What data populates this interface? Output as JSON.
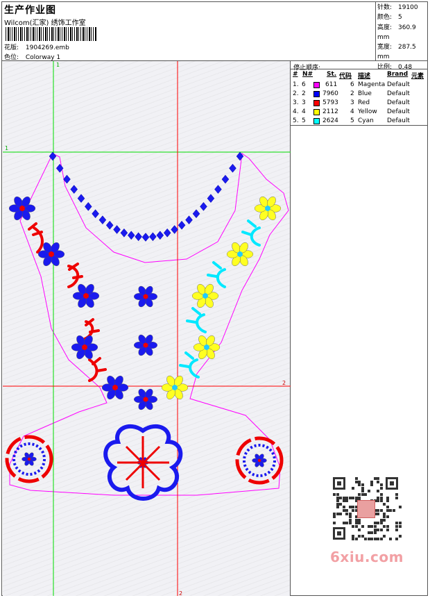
{
  "header": {
    "title": "生产作业图",
    "studio": "Wilcom(汇家) 绣饰工作室",
    "design_label": "花版:",
    "design_value": "1904269.emb",
    "colorway_label": "色位:",
    "colorway_value": "Colorway 1"
  },
  "specs": [
    {
      "label": "针数:",
      "value": "19100"
    },
    {
      "label": "颜色:",
      "value": "5"
    },
    {
      "label": "高度:",
      "value": "360.9 mm"
    },
    {
      "label": "宽度:",
      "value": "287.5 mm"
    },
    {
      "label": "比例:",
      "value": "0.48"
    }
  ],
  "guides": {
    "v1": "1",
    "h1": "1",
    "v2": "2",
    "h2": "2"
  },
  "stop_list": {
    "title": "停止顺序:",
    "headers": {
      "num": "#",
      "needle": "N#",
      "stitch": "St.",
      "code": "代码",
      "desc": "描述",
      "brand": "Brand",
      "element": "元素"
    },
    "rows": [
      {
        "num": "1.",
        "needle": "6",
        "color": "#ff00ff",
        "stitch": "611",
        "code": "6",
        "desc": "Magenta",
        "brand": "Default"
      },
      {
        "num": "2.",
        "needle": "2",
        "color": "#0000ff",
        "stitch": "7960",
        "code": "2",
        "desc": "Blue",
        "brand": "Default"
      },
      {
        "num": "3.",
        "needle": "3",
        "color": "#ff0000",
        "stitch": "5793",
        "code": "3",
        "desc": "Red",
        "brand": "Default"
      },
      {
        "num": "4.",
        "needle": "4",
        "color": "#ffff00",
        "stitch": "2112",
        "code": "4",
        "desc": "Yellow",
        "brand": "Default"
      },
      {
        "num": "5.",
        "needle": "5",
        "color": "#00ffff",
        "stitch": "2624",
        "code": "5",
        "desc": "Cyan",
        "brand": "Default"
      }
    ]
  },
  "watermark": {
    "site": "6xiu.com"
  },
  "colors": {
    "magenta": "#ff00ff",
    "blue": "#1010e0",
    "red": "#ee0000",
    "yellow": "#ffff22",
    "cyan": "#00ffff",
    "guide_green": "#00dd00",
    "guide_red": "#ff0000"
  }
}
